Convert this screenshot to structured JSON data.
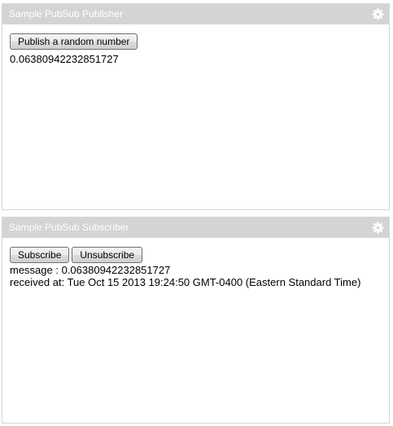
{
  "publisher": {
    "title": "Sample PubSub Publisher",
    "settings_icon": "gear-icon",
    "publish_button": "Publish a random number",
    "value": "0.06380942232851727"
  },
  "subscriber": {
    "title": "Sample PubSub Subscriber",
    "settings_icon": "gear-icon",
    "subscribe_button": "Subscribe",
    "unsubscribe_button": "Unsubscribe",
    "message_line": "message : 0.06380942232851727",
    "received_line": "received at: Tue Oct 15 2013 19:24:50 GMT-0400 (Eastern Standard Time)"
  },
  "colors": {
    "header_bg": "#d4d4d4",
    "header_text": "#ffffff",
    "border": "#d6d6d6"
  }
}
